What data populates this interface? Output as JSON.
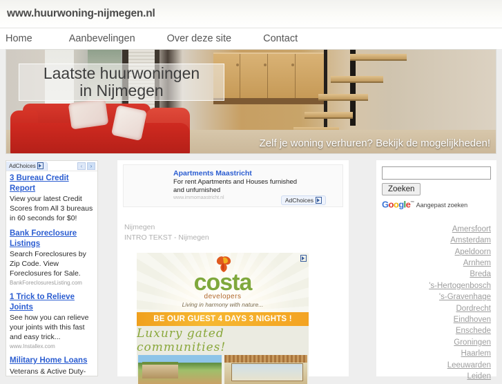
{
  "site": {
    "title": "www.huurwoning-nijmegen.nl"
  },
  "nav": {
    "items": [
      {
        "label": "Home"
      },
      {
        "label": "Aanbevelingen"
      },
      {
        "label": "Over deze site"
      },
      {
        "label": "Contact"
      }
    ]
  },
  "hero": {
    "heading_line1": "Laatste huurwoningen",
    "heading_line2": "in Nijmegen",
    "cta": "Zelf je woning verhuren? Bekijk de mogelijkheden!"
  },
  "left_ads": {
    "adchoices_label": "AdChoices",
    "prev_label": "‹",
    "next_label": "›",
    "items": [
      {
        "title": "3 Bureau Credit Report",
        "desc": "View your latest Credit Scores from All 3 bureaus in 60 seconds for $0!",
        "url": ""
      },
      {
        "title": "Bank Foreclosure Listings",
        "desc": "Search Foreclosures by Zip Code. View Foreclosures for Sale.",
        "url": "BankForeclosuresListing.com"
      },
      {
        "title": "1 Trick to Relieve Joints",
        "desc": "See how you can relieve your joints with this fast and easy trick...",
        "url": "www.Installex.com"
      },
      {
        "title": "Military Home Loans",
        "desc": "Veterans & Active Duty-",
        "url": ""
      }
    ]
  },
  "center": {
    "top_ad": {
      "title": "Apartments Maastricht",
      "desc_line1": "For rent Apartments and Houses furnished",
      "desc_line2": "and unfurnished",
      "url": "www.immomaastricht.nl",
      "adchoices_label": "AdChoices"
    },
    "intro": {
      "city": "Nijmegen",
      "text": "INTRO TEKST - Nijmegen"
    },
    "banner_ad": {
      "brand": "costa",
      "brand_sub": "developers",
      "tagline": "Living in harmony with nature...",
      "offer": "BE OUR GUEST 4 DAYS 3 NIGHTS !",
      "headline": "Luxury gated communities!"
    }
  },
  "right": {
    "search": {
      "value": "",
      "placeholder": "",
      "button_label": "Zoeken",
      "google_g": "G",
      "google_o1": "o",
      "google_o2": "o",
      "google_g2": "g",
      "google_l": "l",
      "google_e": "e",
      "trademark": "™",
      "custom_search_label": "Aangepast zoeken"
    },
    "cities": [
      {
        "label": "Amersfoort"
      },
      {
        "label": "Amsterdam"
      },
      {
        "label": "Apeldoorn"
      },
      {
        "label": "Arnhem"
      },
      {
        "label": "Breda"
      },
      {
        "label": "'s-Hertogenbosch"
      },
      {
        "label": "'s-Gravenhage"
      },
      {
        "label": "Dordrecht"
      },
      {
        "label": "Eindhoven"
      },
      {
        "label": "Enschede"
      },
      {
        "label": "Groningen"
      },
      {
        "label": "Haarlem"
      },
      {
        "label": "Leeuwarden"
      },
      {
        "label": "Leiden"
      }
    ]
  },
  "colors": {
    "link_blue": "#2b5dd1",
    "city_gray": "#9d9d9d",
    "sofa_red": "#cf2a20",
    "costa_green": "#7fa83c",
    "costa_orange": "#f0a01e"
  }
}
